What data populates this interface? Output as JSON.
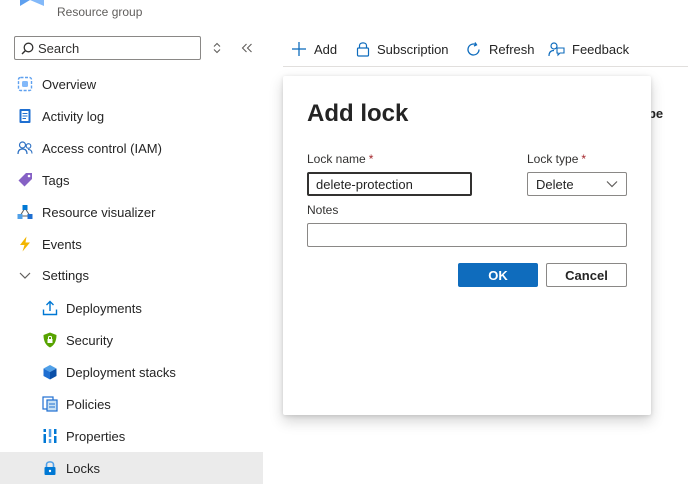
{
  "header": {
    "subtitle": "Resource group"
  },
  "search": {
    "placeholder": "Search"
  },
  "sidebar": {
    "items": [
      {
        "label": "Overview",
        "icon": "overview-icon"
      },
      {
        "label": "Activity log",
        "icon": "activity-log-icon"
      },
      {
        "label": "Access control (IAM)",
        "icon": "people-icon"
      },
      {
        "label": "Tags",
        "icon": "tag-icon"
      },
      {
        "label": "Resource visualizer",
        "icon": "visualizer-icon"
      },
      {
        "label": "Events",
        "icon": "lightning-icon"
      },
      {
        "label": "Settings",
        "icon": "chevron-down-icon"
      },
      {
        "label": "Deployments",
        "icon": "upload-icon"
      },
      {
        "label": "Security",
        "icon": "shield-icon"
      },
      {
        "label": "Deployment stacks",
        "icon": "cube-icon"
      },
      {
        "label": "Policies",
        "icon": "policy-icon"
      },
      {
        "label": "Properties",
        "icon": "properties-icon"
      },
      {
        "label": "Locks",
        "icon": "lock-icon"
      }
    ]
  },
  "toolbar": {
    "add_label": "Add",
    "subscription_label": "Subscription",
    "refresh_label": "Refresh",
    "feedback_label": "Feedback"
  },
  "background": {
    "column_fragment": "ope"
  },
  "dialog": {
    "title": "Add lock",
    "lock_name_label": "Lock name",
    "lock_name_value": "delete-protection",
    "lock_type_label": "Lock type",
    "lock_type_value": "Delete",
    "notes_label": "Notes",
    "notes_value": "",
    "required_marker": "*",
    "ok_label": "OK",
    "cancel_label": "Cancel"
  },
  "colors": {
    "accent": "#0f6cbd",
    "selected_bg": "#ebebeb",
    "required": "#a4262c"
  }
}
